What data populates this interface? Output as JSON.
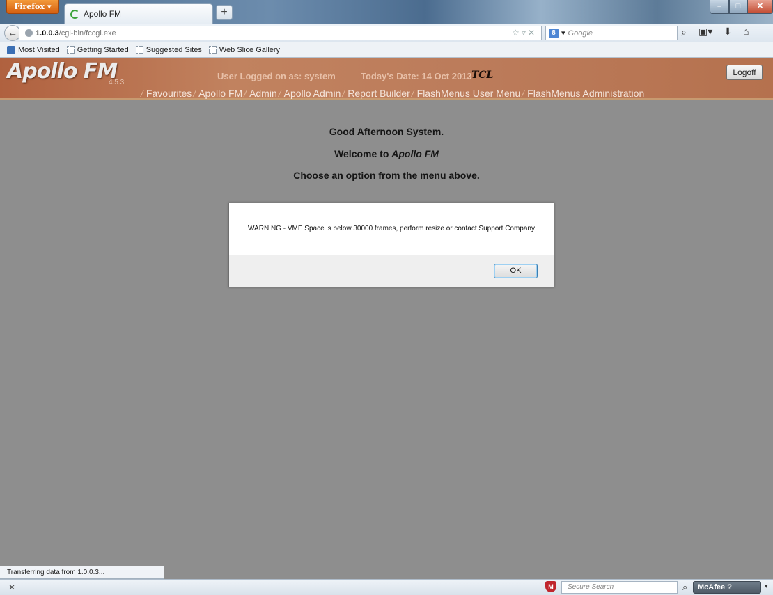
{
  "browser": {
    "menu_button": "Firefox",
    "tab_title": "Apollo FM",
    "new_tab": "+",
    "url_host": "1.0.0.3",
    "url_path": "/cgi-bin/fccgi.exe",
    "search_engine_icon": "8",
    "search_placeholder": "Google",
    "bookmarks": [
      "Most Visited",
      "Getting Started",
      "Suggested Sites",
      "Web Slice Gallery"
    ],
    "status_text": "Transferring data from 1.0.0.3...",
    "secure_search_placeholder": "Secure Search",
    "mcafee_label": "McAfee"
  },
  "app": {
    "logo": "Apollo FM",
    "version": "4.5.3",
    "user_info": "User Logged on as: system",
    "date_info": "Today's Date: 14 Oct 2013",
    "company_logo": "TCL",
    "logoff_label": "Logoff",
    "menu": [
      "Favourites",
      "Apollo FM",
      "Admin",
      "Apollo Admin",
      "Report Builder",
      "FlashMenus User Menu",
      "FlashMenus Administration"
    ]
  },
  "content": {
    "greeting": "Good Afternoon  System.",
    "welcome_prefix": "Welcome to ",
    "welcome_app": "Apollo FM",
    "choose": "Choose an option from the menu above."
  },
  "dialog": {
    "message": "WARNING - VME Space is below 30000 frames, perform resize or contact Support Company",
    "ok_label": "OK"
  },
  "colors": {
    "header_accent": "#b9764f",
    "page_background": "#8e8e8e",
    "dialog_background": "#ffffff"
  }
}
